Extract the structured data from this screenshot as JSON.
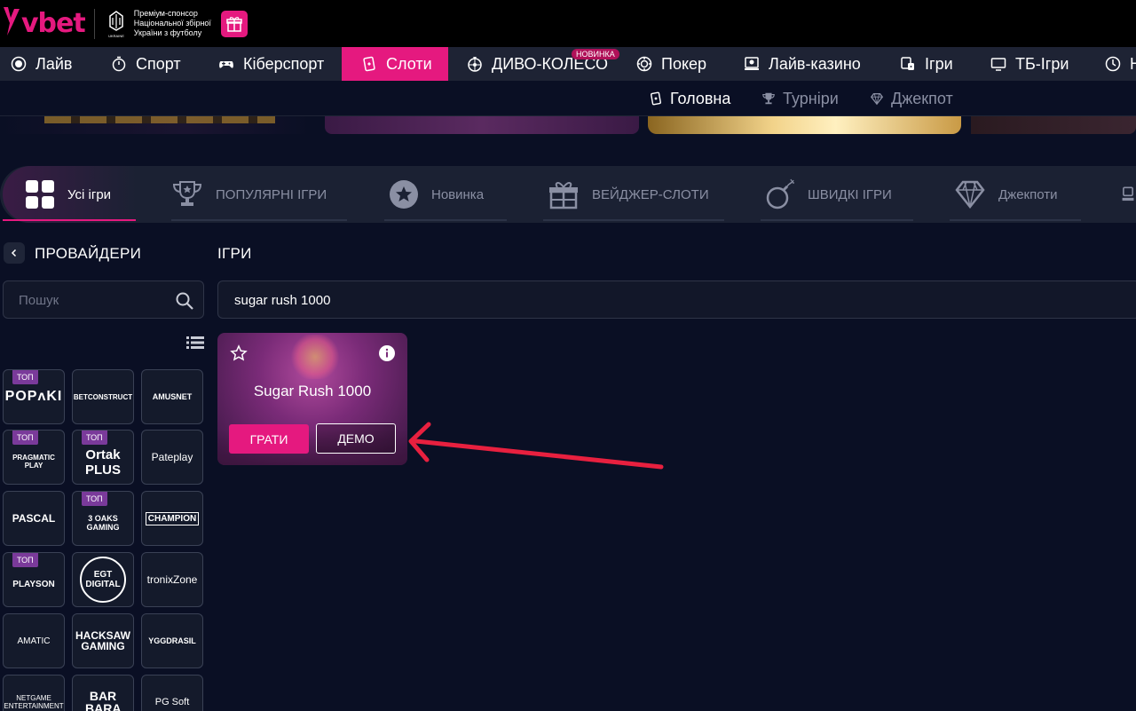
{
  "brand": {
    "logo_text": "vbet",
    "sponsor_line1": "Преміум-спонсор",
    "sponsor_line2": "Національної збірної",
    "sponsor_line3": "України з футболу",
    "crest_caption": "UKRAINE"
  },
  "main_nav": [
    {
      "label": "Лайв",
      "icon": "live-dot-icon"
    },
    {
      "label": "Спорт",
      "icon": "stopwatch-icon"
    },
    {
      "label": "Кіберспорт",
      "icon": "gamepad-icon"
    },
    {
      "label": "Слоти",
      "icon": "cards-icon",
      "active": true
    },
    {
      "label": "ДИВО-КОЛЕСО",
      "icon": "wheel-icon",
      "badge": "НОВИНКА"
    },
    {
      "label": "Покер",
      "icon": "chip-icon"
    },
    {
      "label": "Лайв-казино",
      "icon": "dealer-icon"
    },
    {
      "label": "Ігри",
      "icon": "dice-icon"
    },
    {
      "label": "ТБ-Ігри",
      "icon": "tv-icon"
    },
    {
      "label": "Н",
      "icon": "clock-icon"
    }
  ],
  "sub_nav": [
    {
      "label": "Головна",
      "active": true
    },
    {
      "label": "Турніри"
    },
    {
      "label": "Джекпот"
    }
  ],
  "categories": [
    {
      "label": "Усі ігри",
      "active": true
    },
    {
      "label": "ПОПУЛЯРНІ ІГРИ"
    },
    {
      "label": "Новинка"
    },
    {
      "label": "ВЕЙДЖЕР-СЛОТИ"
    },
    {
      "label": "ШВИДКІ ІГРИ"
    },
    {
      "label": "Джекпоти"
    }
  ],
  "providers_panel": {
    "title": "ПРОВАЙДЕРИ",
    "search_placeholder": "Пошук"
  },
  "providers": [
    {
      "name": "POPʌKI",
      "badge": "ТОП"
    },
    {
      "name": "BETCONSTRUCT"
    },
    {
      "name": "AMUSNET"
    },
    {
      "name": "PRAGMATIC PLAY",
      "badge": "ТОП"
    },
    {
      "name": "Ortak PLUS",
      "badge": "ТОП"
    },
    {
      "name": "Pateplay"
    },
    {
      "name": "PASCAL"
    },
    {
      "name": "3 OAKS GAMING",
      "badge": "ТОП"
    },
    {
      "name": "CHAMPION"
    },
    {
      "name": "PLAYSON",
      "badge": "ТОП"
    },
    {
      "name": "EGT DIGITAL"
    },
    {
      "name": "tronixZone"
    },
    {
      "name": "AMATIC"
    },
    {
      "name": "HACKSAW GAMING"
    },
    {
      "name": "YGGDRASIL"
    },
    {
      "name": "NETGAME ENTERTAINMENT"
    },
    {
      "name": "BAR BARA"
    },
    {
      "name": "PG Soft"
    }
  ],
  "games_panel": {
    "title": "ІГРИ",
    "search_value": "sugar rush 1000"
  },
  "game_card": {
    "title": "Sugar Rush 1000",
    "play_label": "ГРАТИ",
    "demo_label": "ДЕМО"
  },
  "colors": {
    "accent": "#e5197f",
    "background": "#0a0f24",
    "panel": "#1e2334",
    "annotation_arrow": "#e8203f"
  }
}
